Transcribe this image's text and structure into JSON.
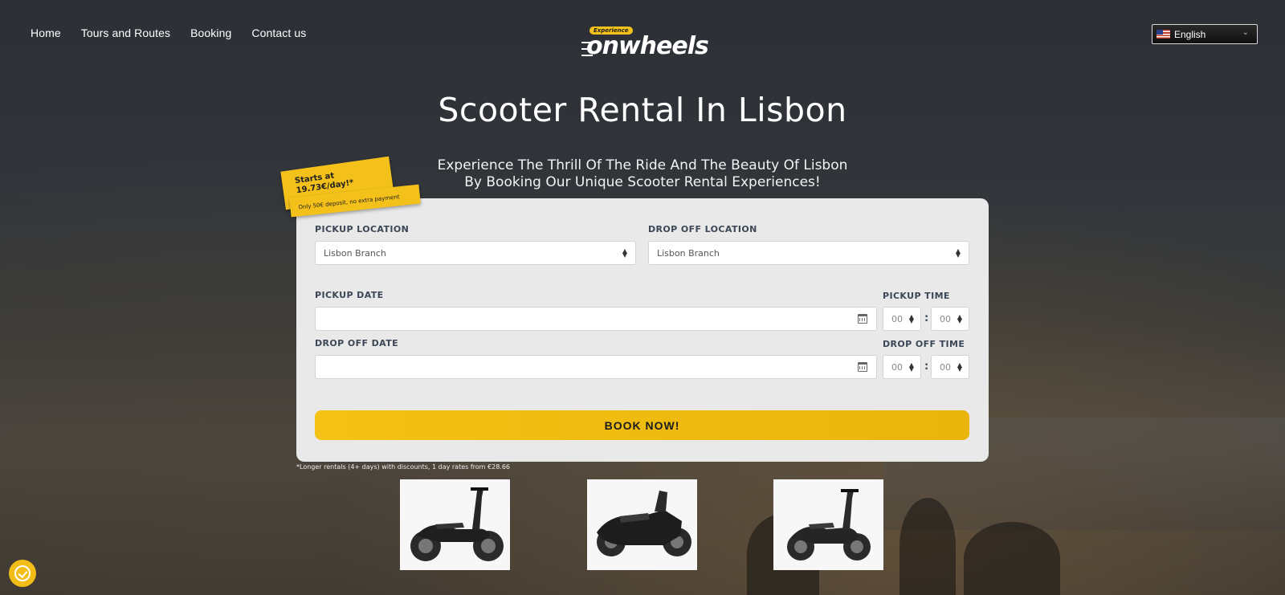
{
  "nav": {
    "items": [
      {
        "label": "Home"
      },
      {
        "label": "Tours and Routes"
      },
      {
        "label": "Booking"
      },
      {
        "label": "Contact us"
      }
    ]
  },
  "logo": {
    "badge": "Experience",
    "word": "onwheels"
  },
  "language": {
    "selected": "English",
    "flag_icon": "us-flag-icon"
  },
  "hero": {
    "title": "Scooter Rental In Lisbon",
    "subtitle": "Experience The Thrill Of The Ride And The Beauty Of Lisbon By Booking Our Unique Scooter Rental Experiences!"
  },
  "sticker": {
    "line1": "Starts at",
    "line2": "19.73€/day!*",
    "line3": "Only 50€ deposit, no extra payment"
  },
  "form": {
    "pickup_location_label": "PICKUP LOCATION",
    "pickup_location_value": "Lisbon Branch",
    "dropoff_location_label": "DROP OFF LOCATION",
    "dropoff_location_value": "Lisbon Branch",
    "pickup_date_label": "PICKUP DATE",
    "pickup_time_label": "PICKUP TIME",
    "pickup_hour": "00",
    "pickup_minute": "00",
    "dropoff_date_label": "DROP OFF DATE",
    "dropoff_time_label": "DROP OFF TIME",
    "dropoff_hour": "00",
    "dropoff_minute": "00",
    "time_separator": ":",
    "book_label": "BOOK NOW!"
  },
  "footnote": "*Longer rentals (4+ days) with discounts, 1 day rates from €28.66",
  "colors": {
    "accent": "#f4c214",
    "card": "#e9e9e9",
    "label": "#3b4656"
  }
}
